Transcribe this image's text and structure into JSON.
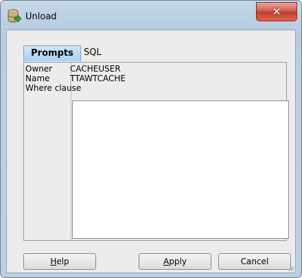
{
  "window": {
    "title": "Unload",
    "close_glyph": "✕",
    "icon": "database-export-icon"
  },
  "tabs": [
    {
      "label": "Prompts",
      "selected": true
    },
    {
      "label": "SQL",
      "selected": false
    }
  ],
  "prompts": {
    "owner_label": "Owner",
    "owner_value": "CACHEUSER",
    "name_label": "Name",
    "name_value": "TTAWTCACHE",
    "where_label": "Where clause",
    "where_value": ""
  },
  "buttons": {
    "help": {
      "mnemonic": "H",
      "rest": "elp"
    },
    "apply": {
      "mnemonic": "A",
      "rest": "pply"
    },
    "cancel": {
      "label": "Cancel"
    }
  },
  "colors": {
    "title_bar": "#c6d8ea",
    "close_button": "#c13b2d",
    "selected_tab": "#a9d0f1"
  }
}
